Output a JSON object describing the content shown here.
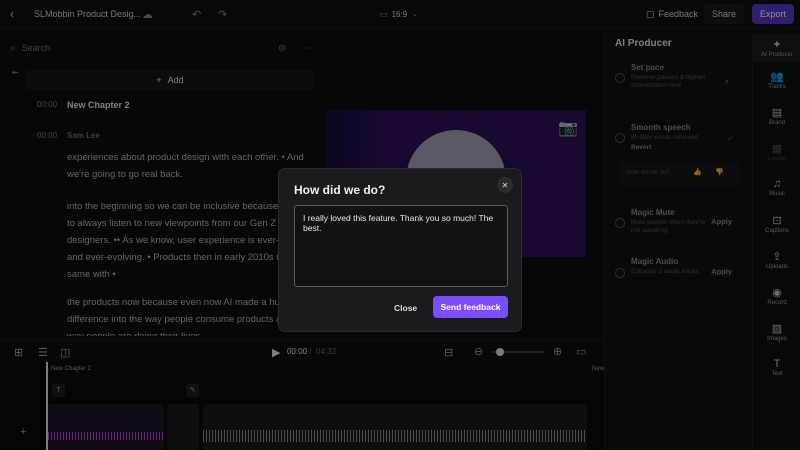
{
  "topbar": {
    "back_icon": "chevron-left-icon",
    "project_title": "SLMobbin Product Desig...",
    "aspect_ratio": "16:9",
    "feedback_label": "Feedback",
    "share_label": "Share",
    "export_label": "Export"
  },
  "left": {
    "search_placeholder": "Search",
    "add_label": "Add",
    "rows": [
      {
        "time": "00:00",
        "text": "New Chapter 2"
      },
      {
        "time": "00:00",
        "text": "Sam Lee"
      }
    ],
    "paragraphs": [
      "experiences about product design with each other. • And we're going to go real back.",
      "into the beginning so we can be inclusive because we want to always listen to new viewpoints from our Gen Z designers. •• As we know, user experience is ever-growing and ever-evolving. • Products then in early 2010s is not the same with •",
      "the products now because even now AI made a huge difference into the way people consume products and the way people are doing their lives"
    ]
  },
  "right_panel": {
    "title": "AI Producer",
    "items": [
      {
        "title": "Set pace",
        "desc": "Remove pauses & tighten conversation flow"
      },
      {
        "title": "Smooth speech",
        "desc": "80 filler words removed",
        "extra": "Revert"
      },
      {
        "title": "Magic Mute",
        "desc": "Mute people when they're not speaking",
        "action": "Apply"
      },
      {
        "title": "Magic Audio",
        "desc": "Enhance 2 audio tracks",
        "action": "Apply"
      }
    ],
    "rating_prompt": "How did we do?"
  },
  "sidebar": {
    "items": [
      {
        "label": "AI Producer",
        "icon": "sparkle-icon"
      },
      {
        "label": "Tracks",
        "icon": "users-icon"
      },
      {
        "label": "Brand",
        "icon": "brand-icon"
      },
      {
        "label": "Layout",
        "icon": "layout-icon"
      },
      {
        "label": "Music",
        "icon": "music-icon"
      },
      {
        "label": "Captions",
        "icon": "captions-icon"
      },
      {
        "label": "Uploads",
        "icon": "upload-icon"
      },
      {
        "label": "Record",
        "icon": "record-icon"
      },
      {
        "label": "Images",
        "icon": "image-icon"
      },
      {
        "label": "Text",
        "icon": "text-icon"
      }
    ]
  },
  "playback": {
    "current_time": "00:00",
    "total_time": "04:32"
  },
  "timeline": {
    "chapter_label": "New Chapter 2",
    "chapter_label_right": "New"
  },
  "modal": {
    "title": "How did we do?",
    "feedback_text": "I really loved this feature. Thank you so much! The best.",
    "close_label": "Close",
    "send_label": "Send feedback"
  },
  "colors": {
    "accent": "#7c4dff",
    "background": "#0d0d0f"
  }
}
